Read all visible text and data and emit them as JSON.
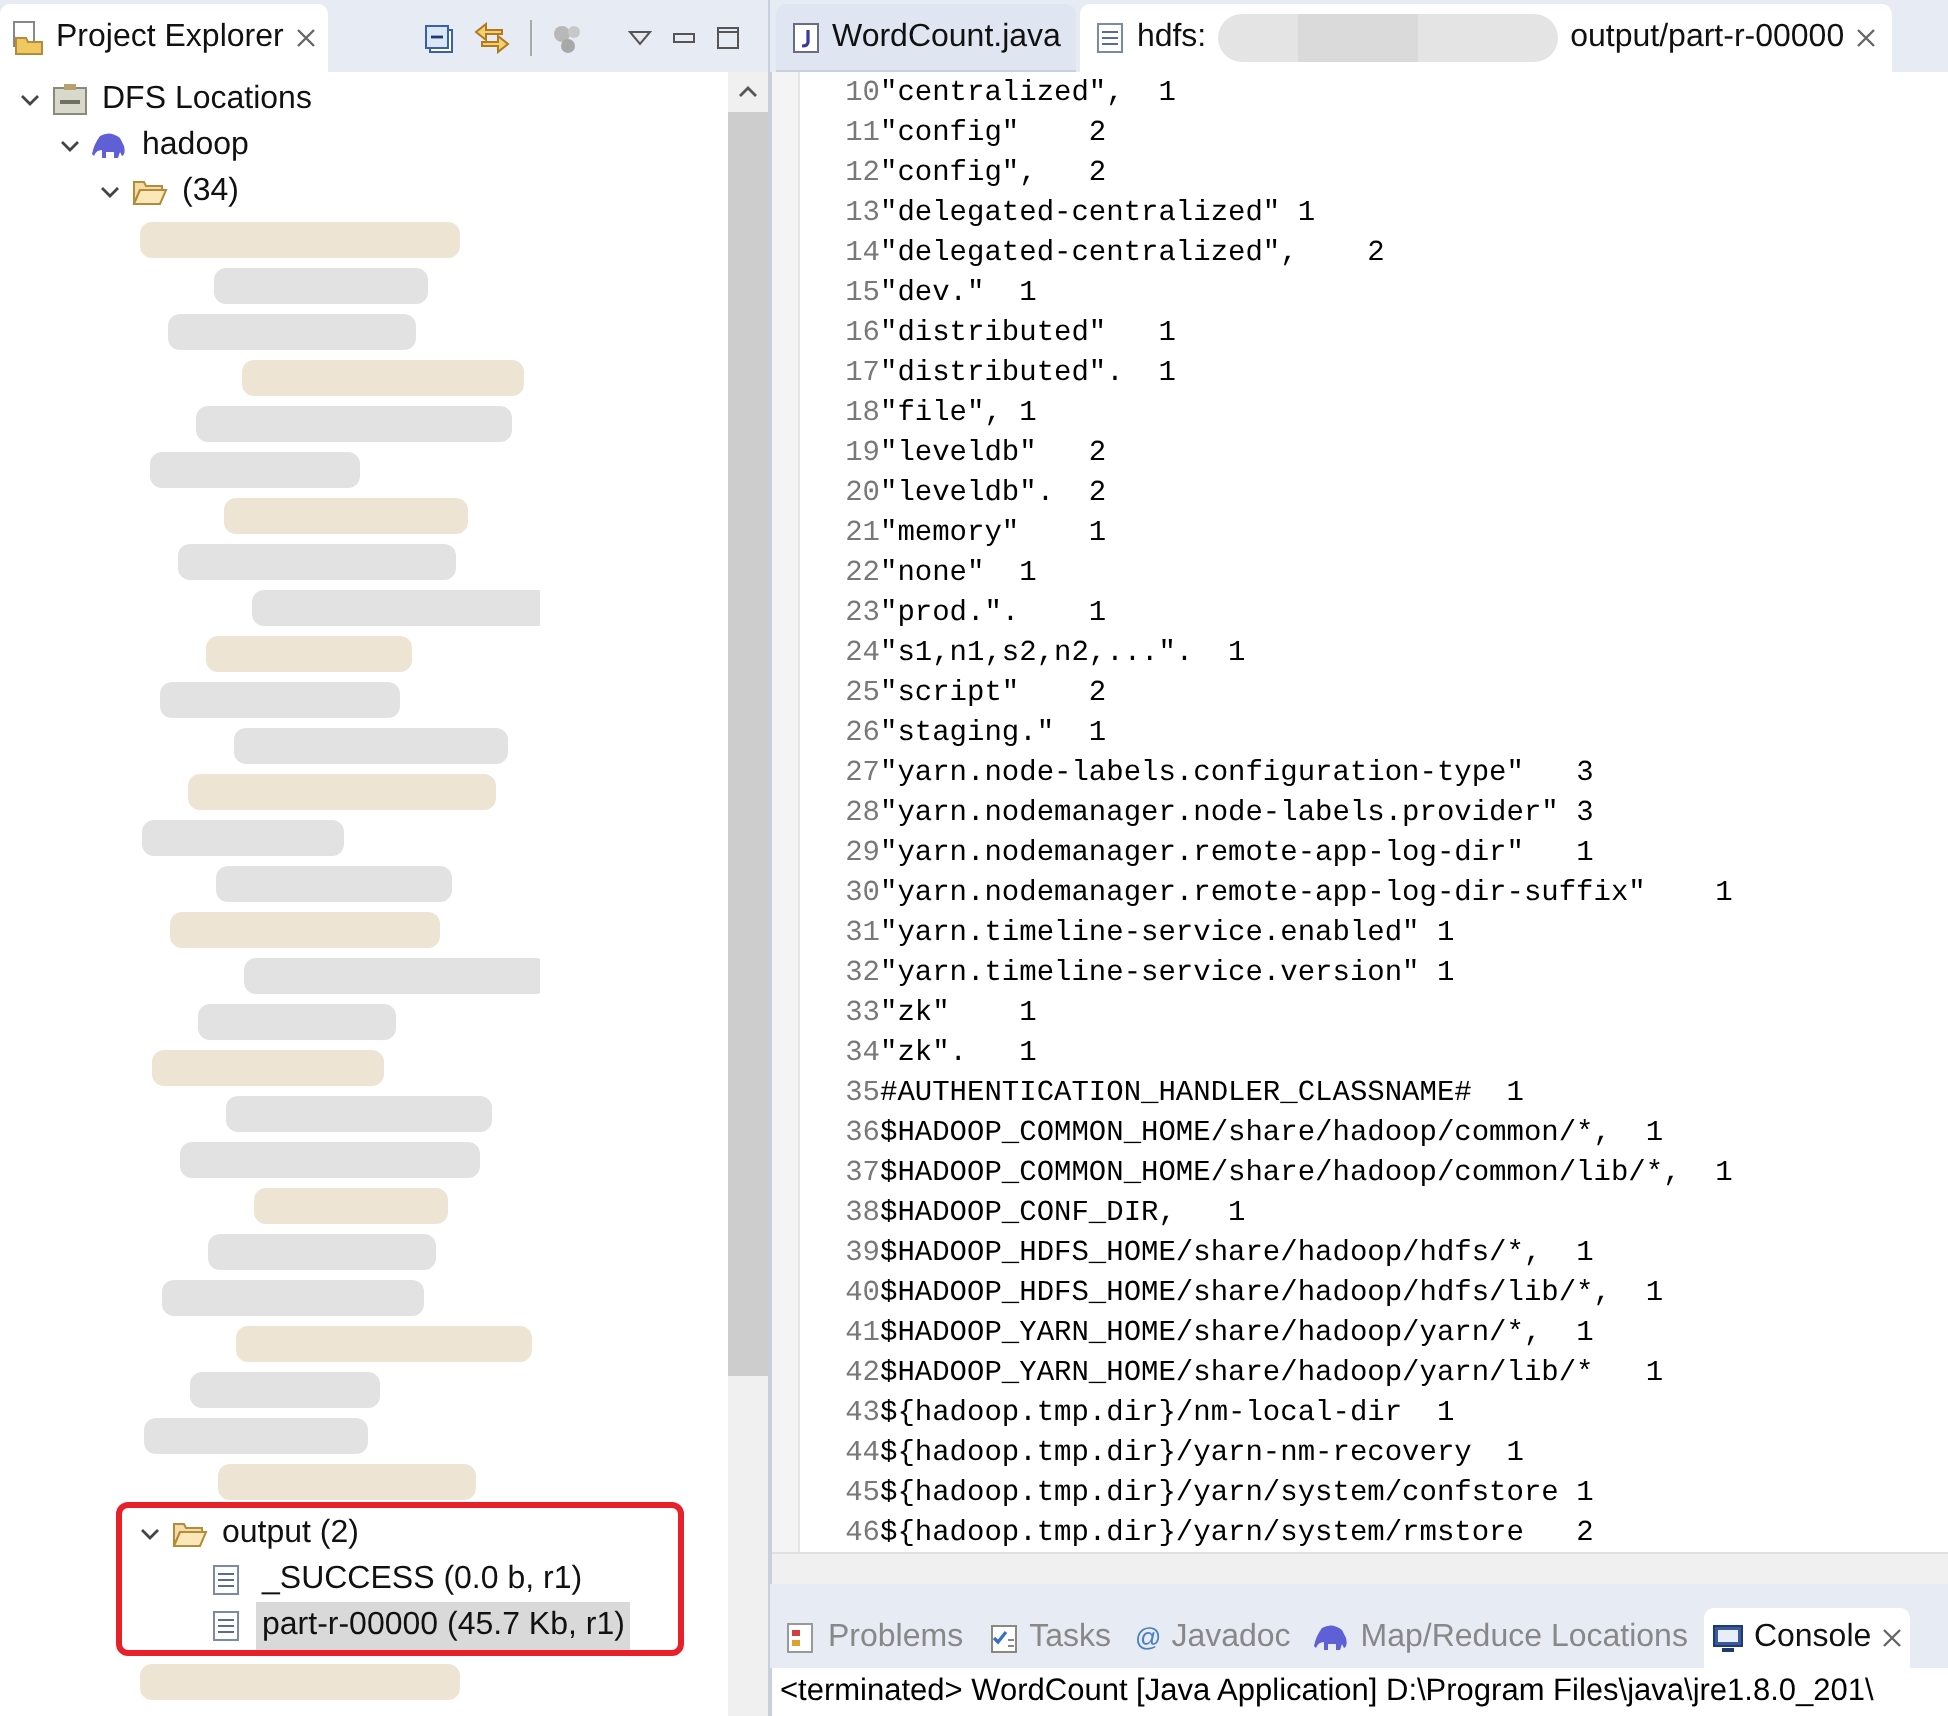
{
  "explorer": {
    "title": "Project Explorer",
    "tree": [
      {
        "label": "DFS Locations",
        "kind": "server",
        "expanded": true,
        "selected": false,
        "children": [
          {
            "label": "hadoop",
            "kind": "elephant",
            "expanded": true,
            "selected": false,
            "children": [
              {
                "label": "(34)",
                "kind": "folder",
                "expanded": true,
                "selected": false,
                "children": [
                  {
                    "label": "output (2)",
                    "kind": "folder",
                    "expanded": true,
                    "selected": false,
                    "highlighted": true,
                    "children": [
                      {
                        "label": "_SUCCESS (0.0 b, r1)",
                        "kind": "file",
                        "selected": false
                      },
                      {
                        "label": "part-r-00000 (45.7 Kb, r1)",
                        "kind": "file",
                        "selected": true
                      }
                    ]
                  }
                ]
              }
            ]
          }
        ]
      }
    ]
  },
  "editor": {
    "tabs": [
      {
        "kind": "java",
        "label": "WordCount.java",
        "selected": false
      },
      {
        "kind": "text",
        "label": "hdfs:",
        "label_end": "output/part-r-00000",
        "selected": true
      }
    ],
    "lines": [
      {
        "n": "10",
        "word": "\"centralized\",",
        "count": "1"
      },
      {
        "n": "11",
        "word": "\"config\"",
        "count": "2"
      },
      {
        "n": "12",
        "word": "\"config\",",
        "count": "2"
      },
      {
        "n": "13",
        "word": "\"delegated-centralized\"",
        "count": "1"
      },
      {
        "n": "14",
        "word": "\"delegated-centralized\",",
        "count": "2"
      },
      {
        "n": "15",
        "word": "\"dev.\"",
        "count": "1"
      },
      {
        "n": "16",
        "word": "\"distributed\"",
        "count": "1"
      },
      {
        "n": "17",
        "word": "\"distributed\".",
        "count": "1"
      },
      {
        "n": "18",
        "word": "\"file\",",
        "count": "1"
      },
      {
        "n": "19",
        "word": "\"leveldb\"",
        "count": "2"
      },
      {
        "n": "20",
        "word": "\"leveldb\".",
        "count": "2"
      },
      {
        "n": "21",
        "word": "\"memory\"",
        "count": "1"
      },
      {
        "n": "22",
        "word": "\"none\"",
        "count": "1"
      },
      {
        "n": "23",
        "word": "\"prod.\".",
        "count": "1"
      },
      {
        "n": "24",
        "word": "\"s1,n1,s2,n2,...\".",
        "count": "1"
      },
      {
        "n": "25",
        "word": "\"script\"",
        "count": "2"
      },
      {
        "n": "26",
        "word": "\"staging.\"",
        "count": "1"
      },
      {
        "n": "27",
        "word": "\"yarn.node-labels.configuration-type\"",
        "count": "3"
      },
      {
        "n": "28",
        "word": "\"yarn.nodemanager.node-labels.provider\"",
        "count": "3"
      },
      {
        "n": "29",
        "word": "\"yarn.nodemanager.remote-app-log-dir\"",
        "count": "1"
      },
      {
        "n": "30",
        "word": "\"yarn.nodemanager.remote-app-log-dir-suffix\"",
        "count": "1"
      },
      {
        "n": "31",
        "word": "\"yarn.timeline-service.enabled\"",
        "count": "1"
      },
      {
        "n": "32",
        "word": "\"yarn.timeline-service.version\"",
        "count": "1"
      },
      {
        "n": "33",
        "word": "\"zk\"",
        "count": "1"
      },
      {
        "n": "34",
        "word": "\"zk\".",
        "count": "1"
      },
      {
        "n": "35",
        "word": "#AUTHENTICATION_HANDLER_CLASSNAME#",
        "count": "1"
      },
      {
        "n": "36",
        "word": "$HADOOP_COMMON_HOME/share/hadoop/common/*,",
        "count": "1"
      },
      {
        "n": "37",
        "word": "$HADOOP_COMMON_HOME/share/hadoop/common/lib/*,",
        "count": "1"
      },
      {
        "n": "38",
        "word": "$HADOOP_CONF_DIR,",
        "count": "1"
      },
      {
        "n": "39",
        "word": "$HADOOP_HDFS_HOME/share/hadoop/hdfs/*,",
        "count": "1"
      },
      {
        "n": "40",
        "word": "$HADOOP_HDFS_HOME/share/hadoop/hdfs/lib/*,",
        "count": "1"
      },
      {
        "n": "41",
        "word": "$HADOOP_YARN_HOME/share/hadoop/yarn/*,",
        "count": "1"
      },
      {
        "n": "42",
        "word": "$HADOOP_YARN_HOME/share/hadoop/yarn/lib/*",
        "count": "1"
      },
      {
        "n": "43",
        "word": "${hadoop.tmp.dir}/nm-local-dir",
        "count": "1"
      },
      {
        "n": "44",
        "word": "${hadoop.tmp.dir}/yarn-nm-recovery",
        "count": "1"
      },
      {
        "n": "45",
        "word": "${hadoop.tmp.dir}/yarn/system/confstore",
        "count": "1"
      },
      {
        "n": "46",
        "word": "${hadoop.tmp.dir}/yarn/system/rmstore",
        "count": "2"
      }
    ]
  },
  "bottom_panel": {
    "tabs": [
      {
        "kind": "problems",
        "label": "Problems",
        "selected": false
      },
      {
        "kind": "tasks",
        "label": "Tasks",
        "selected": false
      },
      {
        "kind": "javadoc",
        "icon_char": "@",
        "label": "Javadoc",
        "selected": false
      },
      {
        "kind": "mapreduce",
        "label": "Map/Reduce Locations",
        "selected": false
      },
      {
        "kind": "console",
        "label": "Console",
        "selected": true
      }
    ],
    "console_text": "<terminated> WordCount [Java Application] D:\\Program Files\\java\\jre1.8.0_201\\"
  }
}
